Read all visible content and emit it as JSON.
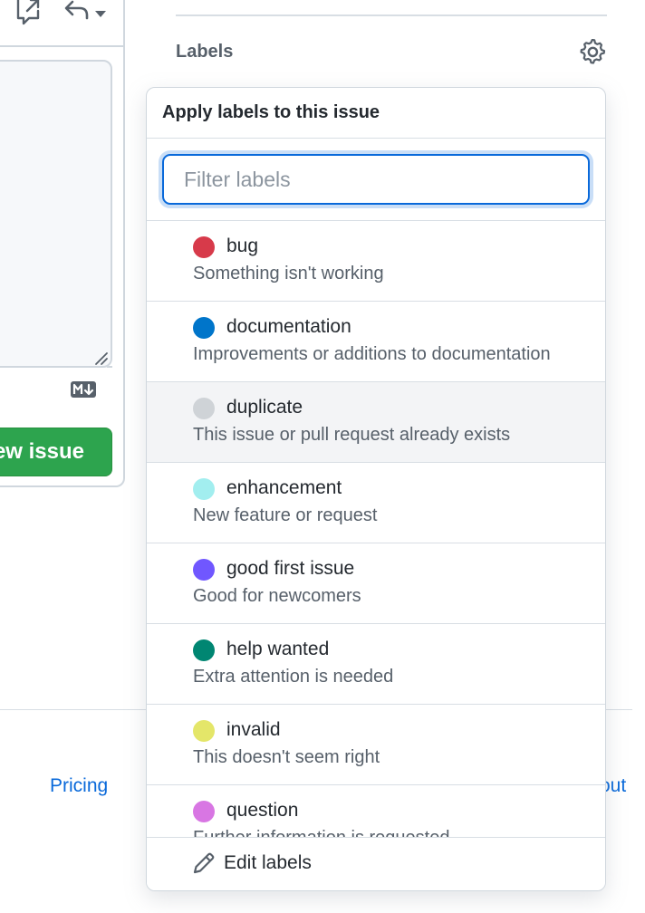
{
  "main": {
    "submit_button_label": "ew issue",
    "markdown_badge": "M↓"
  },
  "footer": {
    "link_pricing": "Pricing",
    "link_about_fragment": "out"
  },
  "sidebar": {
    "labels_heading": "Labels"
  },
  "dropdown": {
    "title": "Apply labels to this issue",
    "filter_placeholder": "Filter labels",
    "filter_value": "",
    "items": [
      {
        "name": "bug",
        "description": "Something isn't working",
        "color": "#d73a4a"
      },
      {
        "name": "documentation",
        "description": "Improvements or additions to documentation",
        "color": "#0075ca"
      },
      {
        "name": "duplicate",
        "description": "This issue or pull request already exists",
        "color": "#cfd3d7"
      },
      {
        "name": "enhancement",
        "description": "New feature or request",
        "color": "#a2eeef"
      },
      {
        "name": "good first issue",
        "description": "Good for newcomers",
        "color": "#7057ff"
      },
      {
        "name": "help wanted",
        "description": "Extra attention is needed",
        "color": "#008672"
      },
      {
        "name": "invalid",
        "description": "This doesn't seem right",
        "color": "#e4e669"
      },
      {
        "name": "question",
        "description": "Further information is requested",
        "color": "#d876e3"
      }
    ],
    "highlighted_item": "duplicate",
    "edit_labels": "Edit labels"
  },
  "icons": {
    "toolbar_left": "link-external-icon",
    "toolbar_right": "reply-icon",
    "toolbar_caret": "triangle-down-icon",
    "settings": "gear-icon",
    "edit": "pencil-icon",
    "resize": "resize-grip-icon",
    "markdown": "markdown-icon"
  }
}
